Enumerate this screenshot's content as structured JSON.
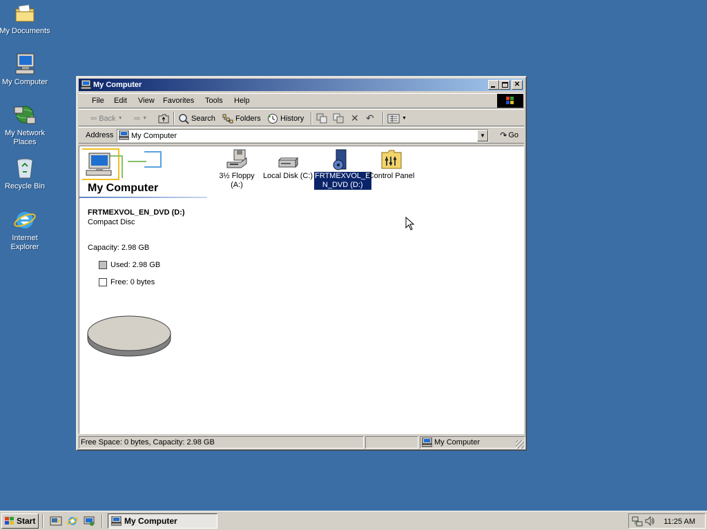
{
  "desktop": {
    "icons": [
      {
        "label": "My Documents",
        "icon": "folder-icon"
      },
      {
        "label": "My Computer",
        "icon": "computer-icon"
      },
      {
        "label": "My Network Places",
        "icon": "network-icon"
      },
      {
        "label": "Recycle Bin",
        "icon": "recycle-bin-icon"
      },
      {
        "label": "Internet Explorer",
        "icon": "ie-icon"
      }
    ]
  },
  "window": {
    "title": "My Computer",
    "menu": [
      "File",
      "Edit",
      "View",
      "Favorites",
      "Tools",
      "Help"
    ],
    "toolbar": {
      "back": "Back",
      "search": "Search",
      "folders": "Folders",
      "history": "History"
    },
    "address": {
      "label": "Address",
      "value": "My Computer",
      "go": "Go"
    },
    "left_pane": {
      "title": "My Computer",
      "drive_name": "FRTMEXVOL_EN_DVD (D:)",
      "drive_type": "Compact Disc",
      "capacity": "Capacity: 2.98 GB",
      "used": "Used: 2.98 GB",
      "free": "Free: 0 bytes",
      "used_color": "#c0c0c0",
      "free_color": "#ffffff"
    },
    "items": [
      {
        "label_line1": "3½ Floppy",
        "label_line2": "(A:)",
        "icon": "floppy-drive-icon",
        "selected": false
      },
      {
        "label_line1": "Local Disk (C:)",
        "label_line2": "",
        "icon": "hard-disk-icon",
        "selected": false
      },
      {
        "label_line1": "FRTMEXVOL_E",
        "label_line2": "N_DVD (D:)",
        "icon": "cd-drive-icon",
        "selected": true
      },
      {
        "label_line1": "Control Panel",
        "label_line2": "",
        "icon": "control-panel-icon",
        "selected": false
      }
    ],
    "status": {
      "left": "Free Space: 0 bytes, Capacity: 2.98 GB",
      "right": "My Computer"
    }
  },
  "taskbar": {
    "start": "Start",
    "task": "My Computer",
    "clock": "11:25 AM"
  },
  "colors": {
    "desktop": "#3a6ea5",
    "title_start": "#0a246a",
    "title_end": "#a6caf0",
    "selection": "#0a246a"
  }
}
